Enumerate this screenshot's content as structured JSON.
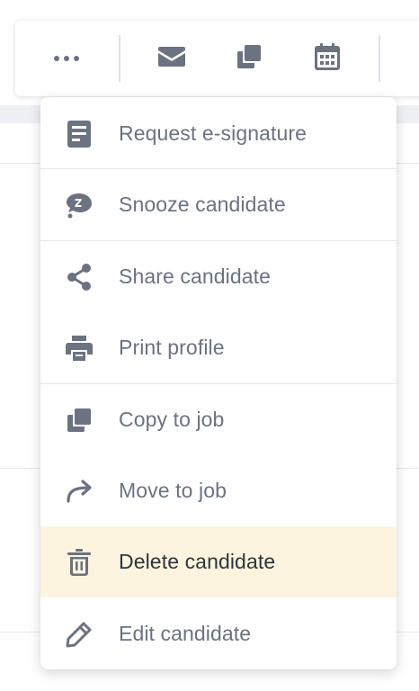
{
  "toolbar": {
    "buttons": [
      {
        "icon": "more-horizontal-icon"
      },
      {
        "icon": "envelope-icon"
      },
      {
        "icon": "copy-icon"
      },
      {
        "icon": "calendar-icon"
      }
    ]
  },
  "menu": {
    "items": [
      {
        "label": "Request e-signature",
        "icon": "document-icon"
      },
      {
        "label": "Snooze candidate",
        "icon": "snooze-icon"
      },
      {
        "label": "Share candidate",
        "icon": "share-icon"
      },
      {
        "label": "Print profile",
        "icon": "printer-icon"
      },
      {
        "label": "Copy to job",
        "icon": "copy-icon"
      },
      {
        "label": "Move to job",
        "icon": "forward-arrow-icon"
      },
      {
        "label": "Delete candidate",
        "icon": "trash-icon",
        "highlighted": true
      },
      {
        "label": "Edit candidate",
        "icon": "pencil-icon"
      }
    ]
  },
  "colors": {
    "icon": "#6b7280",
    "label": "#6b7280",
    "highlight_bg": "#fcf4de",
    "highlight_text": "#2f353d"
  }
}
